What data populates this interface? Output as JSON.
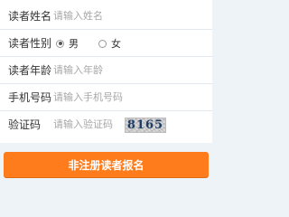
{
  "form": {
    "name": {
      "label": "读者姓名",
      "placeholder": "请输入姓名"
    },
    "gender": {
      "label": "读者性别",
      "options": [
        {
          "label": "男",
          "checked": true
        },
        {
          "label": "女",
          "checked": false
        }
      ]
    },
    "age": {
      "label": "读者年龄",
      "placeholder": "请输入年龄"
    },
    "phone": {
      "label": "手机号码",
      "placeholder": "请输入手机号码"
    },
    "captcha": {
      "label": "验证码",
      "placeholder": "请输入验证码",
      "image_text": "8165"
    }
  },
  "submit_label": "非注册读者报名",
  "colors": {
    "accent": "#fe7c1b",
    "background": "#eef3f7"
  }
}
